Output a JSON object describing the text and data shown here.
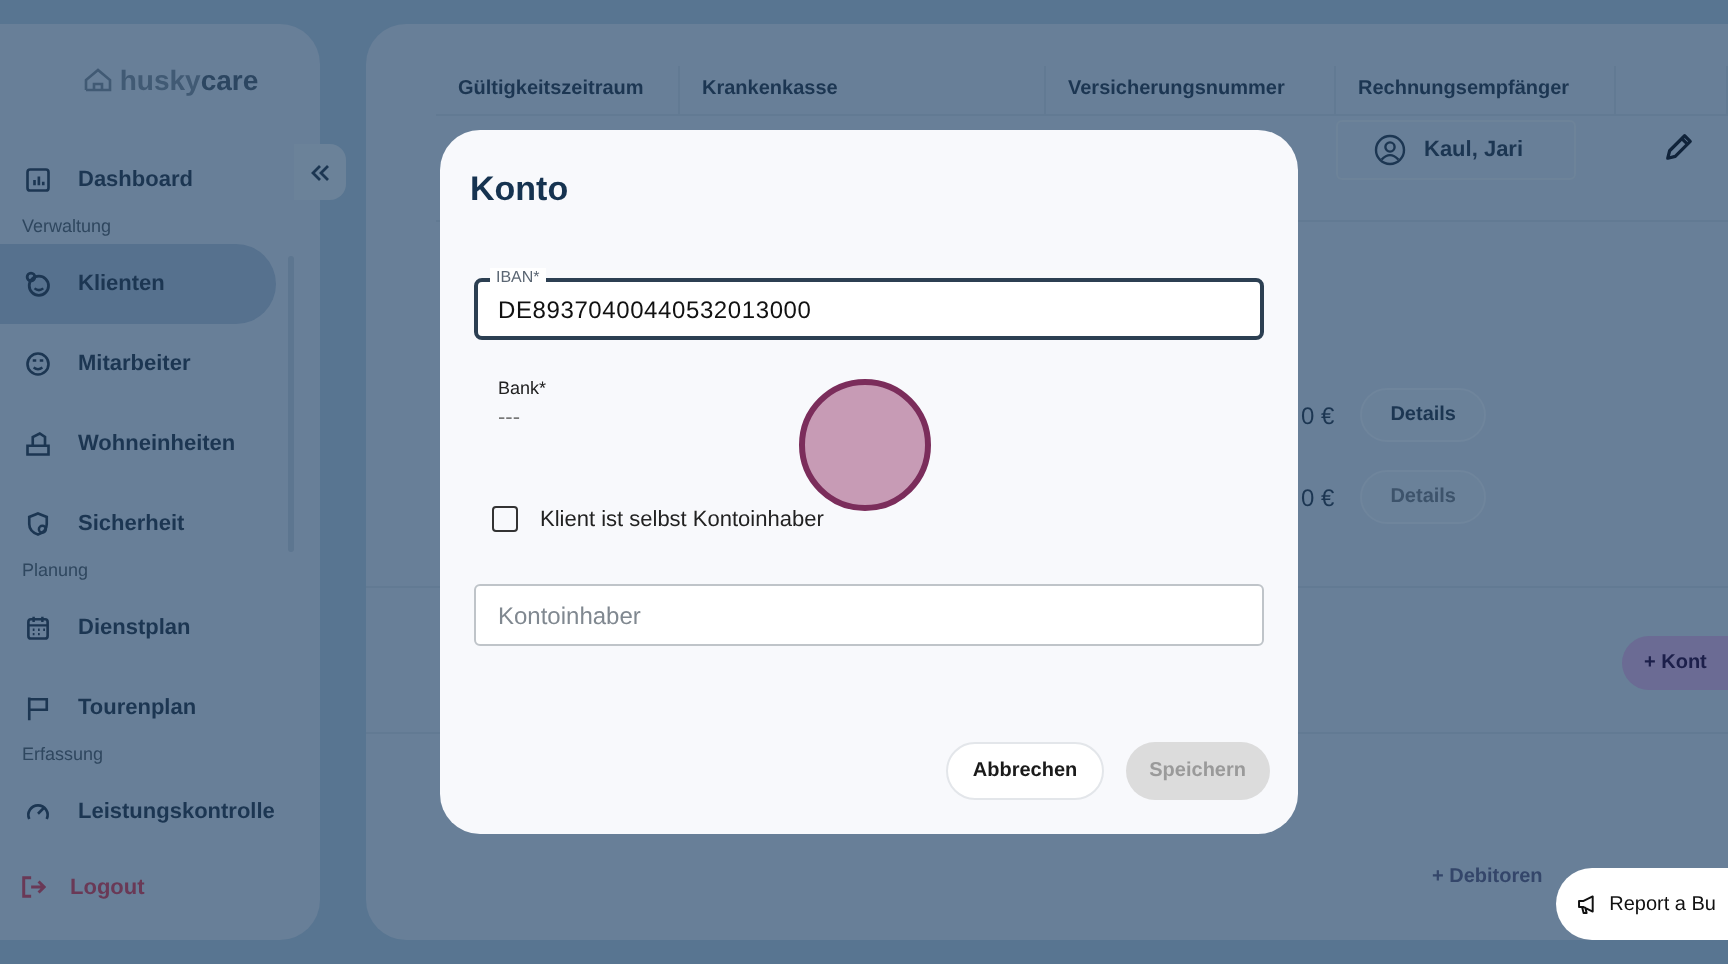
{
  "sidebar": {
    "logo_prefix": "husky",
    "logo_suffix": "care",
    "nav": [
      {
        "kind": "item",
        "label": "Dashboard",
        "selected": false
      },
      {
        "kind": "heading",
        "label": "Verwaltung"
      },
      {
        "kind": "item",
        "label": "Klienten",
        "selected": true
      },
      {
        "kind": "item",
        "label": "Mitarbeiter",
        "selected": false
      },
      {
        "kind": "item",
        "label": "Wohneinheiten",
        "selected": false
      },
      {
        "kind": "item",
        "label": "Sicherheit",
        "selected": false
      },
      {
        "kind": "heading",
        "label": "Planung"
      },
      {
        "kind": "item",
        "label": "Dienstplan",
        "selected": false
      },
      {
        "kind": "item",
        "label": "Tourenplan",
        "selected": false
      },
      {
        "kind": "heading",
        "label": "Erfassung"
      },
      {
        "kind": "item",
        "label": "Leistungskontrolle",
        "selected": false
      }
    ],
    "logout": "Logout"
  },
  "table": {
    "columns": [
      "Gültigkeitszeitraum",
      "Krankenkasse",
      "Versicherungsnummer",
      "Rechnungsempfänger"
    ],
    "rows": [
      {
        "recipient": "Kaul, Jari"
      }
    ]
  },
  "payments": [
    {
      "amount": "0 €",
      "button": "Details",
      "disabled": false
    },
    {
      "amount": "0 €",
      "button": "Details",
      "disabled": true
    }
  ],
  "add_account_button": "+ Kont",
  "add_debtor_link": "+ Debitoren",
  "report_bug_button": "Report a Bu",
  "dialog": {
    "title": "Konto",
    "iban": {
      "label": "IBAN*",
      "value": "DE89370400440532013000"
    },
    "bank": {
      "label": "Bank*",
      "value": "---"
    },
    "owner_is_client": {
      "label": "Klient ist selbst Kontoinhaber",
      "checked": false
    },
    "owner": {
      "placeholder": "Kontoinhaber"
    },
    "cancel": "Abbrechen",
    "save": {
      "label": "Speichern",
      "disabled": true
    }
  }
}
